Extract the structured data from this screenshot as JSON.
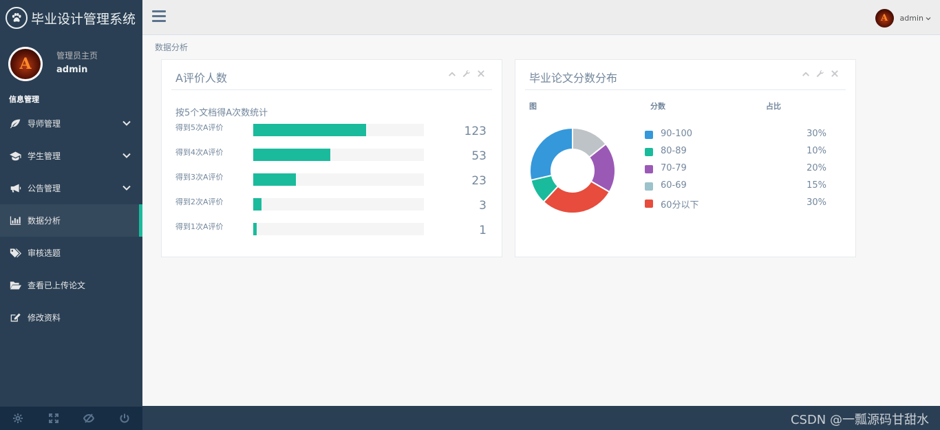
{
  "app": {
    "title": "毕业设计管理系统"
  },
  "sidebar": {
    "profile_welcome": "管理员主页",
    "profile_name": "admin",
    "profile_initial": "A",
    "section": "信息管理",
    "items": [
      {
        "label": "导师管理",
        "icon": "leaf-icon",
        "has_submenu": true
      },
      {
        "label": "学生管理",
        "icon": "graduation-cap-icon",
        "has_submenu": true
      },
      {
        "label": "公告管理",
        "icon": "bullhorn-icon",
        "has_submenu": true
      },
      {
        "label": "数据分析",
        "icon": "bar-chart-icon",
        "active": true
      },
      {
        "label": "审核选题",
        "icon": "tags-icon"
      },
      {
        "label": "查看已上传论文",
        "icon": "folder-open-icon"
      },
      {
        "label": "修改资料",
        "icon": "edit-icon"
      }
    ],
    "footer_icons": [
      "settings-icon",
      "fullscreen-icon",
      "eye-slash-icon",
      "power-icon"
    ]
  },
  "topnav": {
    "user": "admin",
    "user_initial": "A"
  },
  "breadcrumb": "数据分析",
  "left_panel": {
    "title": "A评价人数",
    "caption": "按5个文档得A次数统计",
    "rows": [
      {
        "label": "得到5次A评价",
        "value": "123",
        "fill": 0.66
      },
      {
        "label": "得到4次A评价",
        "value": "53",
        "fill": 0.45
      },
      {
        "label": "得到3次A评价",
        "value": "23",
        "fill": 0.25
      },
      {
        "label": "得到2次A评价",
        "value": "3",
        "fill": 0.05
      },
      {
        "label": "得到1次A评价",
        "value": "1",
        "fill": 0.02
      }
    ]
  },
  "right_panel": {
    "title": "毕业论文分数分布",
    "headers": {
      "chart": "图",
      "score": "分数",
      "ratio": "占比"
    }
  },
  "chart_data": {
    "type": "pie",
    "categories": [
      "90-100",
      "80-89",
      "70-79",
      "60-69",
      "60分以下"
    ],
    "values": [
      30,
      10,
      20,
      15,
      30
    ],
    "value_labels": [
      "30%",
      "10%",
      "20%",
      "15%",
      "30%"
    ],
    "colors": [
      "#3498db",
      "#1abb9c",
      "#9b59b6",
      "#bdc3c7",
      "#e74c3c"
    ],
    "legend_colors": [
      "#3498db",
      "#1abb9c",
      "#9b59b6",
      "#9cc2cb",
      "#e74c3c"
    ],
    "inner_radius_ratio": 0.5
  },
  "watermark": "CSDN @一瓢源码甘甜水"
}
